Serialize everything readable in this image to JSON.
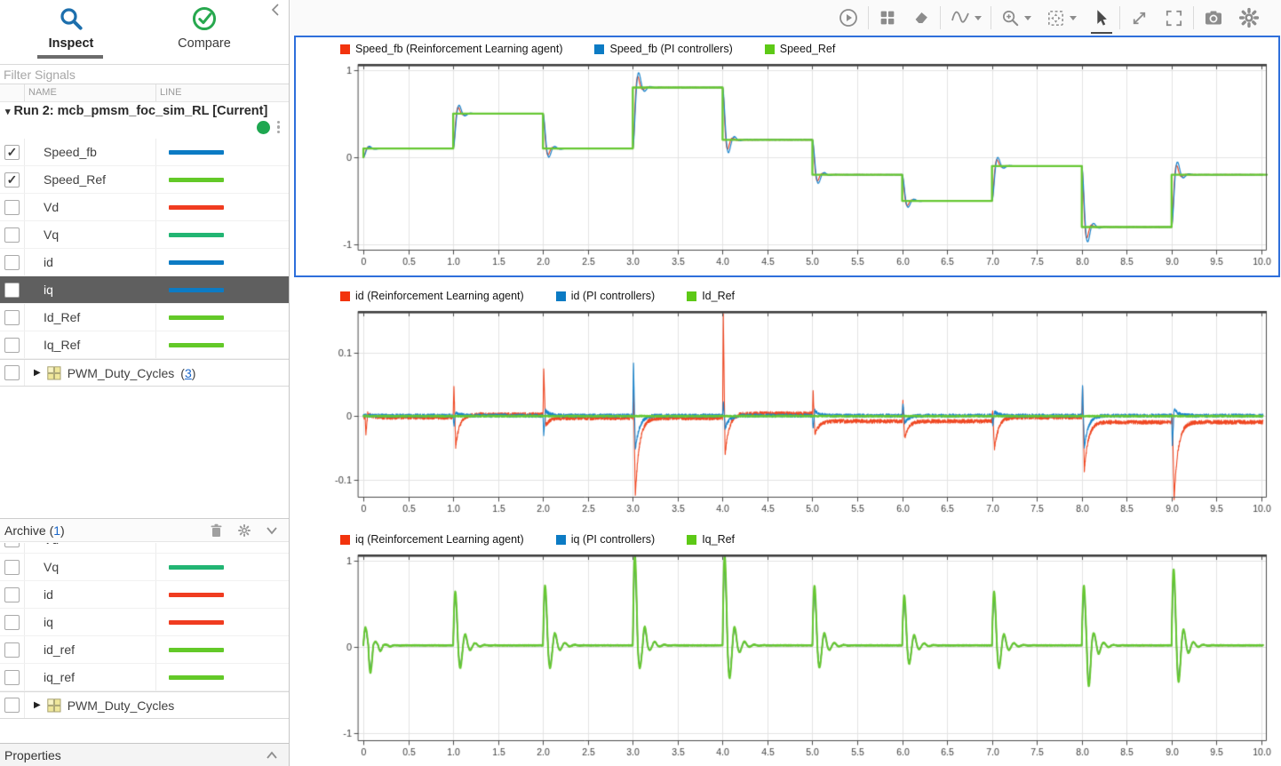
{
  "colors": {
    "accent_blue_selection": "#2E6FDB",
    "selected_row_bg": "#5F5F5F",
    "run_active_dot": "#1EA750",
    "link_blue": "#1A66C9",
    "series_red": "#EF4823",
    "series_blue": "#1B84CC",
    "series_green": "#66C832",
    "series_teal": "#22B573"
  },
  "sidebar": {
    "tabs": [
      {
        "label": "Inspect"
      },
      {
        "label": "Compare"
      }
    ],
    "collapse_icon": "chevron-left",
    "filter_placeholder": "Filter Signals",
    "columns": [
      "NAME",
      "LINE"
    ],
    "count_wrap": [
      "(",
      ")"
    ],
    "run": {
      "title": "Run 2: mcb_pmsm_foc_sim_RL [Current]",
      "signals": [
        {
          "name": "Speed_fb",
          "color": "#0C7BC4",
          "checked": true
        },
        {
          "name": "Speed_Ref",
          "color": "#63C928",
          "checked": true
        },
        {
          "name": "Vd",
          "color": "#F03C20",
          "checked": false
        },
        {
          "name": "Vq",
          "color": "#22B573",
          "checked": false
        },
        {
          "name": "id",
          "color": "#0C7BC4",
          "checked": false
        },
        {
          "name": "iq",
          "color": "#0C7BC4",
          "checked": false,
          "selected": true
        },
        {
          "name": "Id_Ref",
          "color": "#63C928",
          "checked": false
        },
        {
          "name": "Iq_Ref",
          "color": "#63C928",
          "checked": false
        },
        {
          "name": "PWM_Duty_Cycles",
          "group": true,
          "count": "3",
          "checked": false
        }
      ]
    },
    "archive": {
      "label": "Archive ",
      "count": "1",
      "signals": [
        {
          "name": "Vd",
          "color": "#F03C20",
          "checked": false,
          "clipped": true
        },
        {
          "name": "Vq",
          "color": "#22B573",
          "checked": false
        },
        {
          "name": "id",
          "color": "#F03C20",
          "checked": false
        },
        {
          "name": "iq",
          "color": "#F03C20",
          "checked": false
        },
        {
          "name": "id_ref",
          "color": "#63C928",
          "checked": false
        },
        {
          "name": "iq_ref",
          "color": "#63C928",
          "checked": false
        },
        {
          "name": "PWM_Duty_Cycles",
          "group": true,
          "checked": false
        }
      ]
    },
    "properties_label": "Properties"
  },
  "toolbar": {
    "icons": [
      "replay",
      "subplot-layout",
      "eraser",
      "signal-wave",
      "zoom-in",
      "fit-to-view",
      "pointer",
      "expand",
      "fullscreen",
      "snapshot",
      "settings"
    ],
    "active_icon": "pointer"
  },
  "chart_data": [
    {
      "type": "line",
      "legend": [
        {
          "label": "Speed_fb (Reinforcement Learning agent)",
          "color": "#F2330D"
        },
        {
          "label": "Speed_fb (PI controllers)",
          "color": "#0C7BC4"
        },
        {
          "label": "Speed_Ref",
          "color": "#5DC916"
        }
      ],
      "xlim": [
        -0.06,
        10.06
      ],
      "ylim": [
        -1.07,
        1.07
      ],
      "xtick_step": 0.5,
      "xtick_labels": [
        "0",
        "0.5",
        "1.0",
        "1.5",
        "2.0",
        "2.5",
        "3.0",
        "3.5",
        "4.0",
        "4.5",
        "5.0",
        "5.5",
        "6.0",
        "6.5",
        "7.0",
        "7.5",
        "8.0",
        "8.5",
        "9.0",
        "9.5",
        "10.0"
      ],
      "yticks": [
        {
          "v": 1,
          "l": "1"
        },
        {
          "v": 0,
          "l": "0"
        },
        {
          "v": -1,
          "l": "-1"
        }
      ],
      "steps": {
        "times": [
          0,
          1,
          2,
          3,
          4,
          5,
          6,
          7,
          8,
          9
        ],
        "values": [
          0.1,
          0.5,
          0.1,
          0.8,
          0.2,
          -0.2,
          -0.5,
          -0.1,
          -0.8,
          -0.2
        ],
        "initial": 0
      },
      "series": [
        {
          "name": "Speed_fb (Reinforcement Learning agent)",
          "color": "#EF4823",
          "kind": "step_response",
          "tau": 0.032,
          "period": 0.11,
          "noise": 0.003,
          "width": 1.2
        },
        {
          "name": "Speed_fb (PI controllers)",
          "color": "#1B84CC",
          "kind": "step_response",
          "tau": 0.046,
          "period": 0.13,
          "noise": 0.003,
          "width": 1.2
        },
        {
          "name": "Speed_Ref",
          "color": "#66C832",
          "kind": "step",
          "width": 2.3
        }
      ]
    },
    {
      "type": "line",
      "legend": [
        {
          "label": "id (Reinforcement Learning agent)",
          "color": "#F2330D"
        },
        {
          "label": "id (PI controllers)",
          "color": "#0C7BC4"
        },
        {
          "label": "Id_Ref",
          "color": "#5DC916"
        }
      ],
      "xlim": [
        -0.06,
        10.06
      ],
      "ylim": [
        -0.128,
        0.165
      ],
      "xtick_step": 0.5,
      "xtick_labels": [
        "0",
        "0.5",
        "1.0",
        "1.5",
        "2.0",
        "2.5",
        "3.0",
        "3.5",
        "4.0",
        "4.5",
        "5.0",
        "5.5",
        "6.0",
        "6.5",
        "7.0",
        "7.5",
        "8.0",
        "8.5",
        "9.0",
        "9.5",
        "10.0"
      ],
      "yticks": [
        {
          "v": 0.1,
          "l": "0.1"
        },
        {
          "v": 0,
          "l": "0"
        },
        {
          "v": -0.1,
          "l": "-0.1"
        }
      ],
      "series": [
        {
          "name": "id (Reinforcement Learning agent)",
          "color": "#EF4823",
          "kind": "spikes",
          "width": 1.1,
          "noise": 0.0032,
          "baseline": [
            [
              0,
              1,
              -0.002
            ],
            [
              1,
              2,
              0.0025
            ],
            [
              2,
              4,
              -0.003
            ],
            [
              4,
              5,
              0.004
            ],
            [
              5,
              7,
              -0.008
            ],
            [
              7,
              8,
              -0.002
            ],
            [
              8,
              10,
              -0.0095
            ]
          ],
          "events": [
            {
              "t": 0.02,
              "a1": -0.025,
              "a2": 0.006
            },
            {
              "t": 1,
              "a1": 0.045,
              "a2": -0.05
            },
            {
              "t": 2,
              "a1": 0.078,
              "a2": -0.012
            },
            {
              "t": 3,
              "a1": 0.045,
              "a2": -0.122
            },
            {
              "t": 4,
              "a1": 0.155,
              "a2": -0.065
            },
            {
              "t": 5,
              "a1": 0.048,
              "a2": -0.022
            },
            {
              "t": 6,
              "a1": 0.03,
              "a2": -0.027
            },
            {
              "t": 7,
              "a1": 0.008,
              "a2": -0.05
            },
            {
              "t": 8,
              "a1": 0.057,
              "a2": -0.076
            },
            {
              "t": 9,
              "a1": 0.015,
              "a2": -0.12
            }
          ]
        },
        {
          "name": "id (PI controllers)",
          "color": "#1B84CC",
          "kind": "spikes",
          "width": 1.1,
          "noise": 0.0028,
          "baseline": [
            [
              0,
              10,
              0.0008
            ]
          ],
          "events": [
            {
              "t": 1,
              "a1": -0.017,
              "a2": 0.006
            },
            {
              "t": 2,
              "a1": -0.03,
              "a2": 0.008
            },
            {
              "t": 3,
              "a1": 0.085,
              "a2": -0.055
            },
            {
              "t": 4,
              "a1": 0.02,
              "a2": -0.02
            },
            {
              "t": 5,
              "a1": -0.02,
              "a2": 0.008
            },
            {
              "t": 6,
              "a1": 0.02,
              "a2": -0.012
            },
            {
              "t": 7,
              "a1": -0.016,
              "a2": 0.006
            },
            {
              "t": 8,
              "a1": 0.05,
              "a2": -0.05
            },
            {
              "t": 9,
              "a1": -0.05,
              "a2": 0.01
            }
          ]
        },
        {
          "name": "Id_Ref",
          "color": "#66C832",
          "kind": "flat",
          "width": 1.6,
          "noise": 0.0012,
          "baseline": [
            [
              0,
              10,
              0
            ]
          ]
        }
      ]
    },
    {
      "type": "line",
      "legend": [
        {
          "label": "iq (Reinforcement Learning agent)",
          "color": "#F2330D"
        },
        {
          "label": "iq (PI controllers)",
          "color": "#0C7BC4"
        },
        {
          "label": "Iq_Ref",
          "color": "#5DC916"
        }
      ],
      "xlim": [
        -0.06,
        10.06
      ],
      "ylim": [
        -1.09,
        1.07
      ],
      "xtick_step": 0.5,
      "xtick_labels": [
        "0",
        "0.5",
        "1.0",
        "1.5",
        "2.0",
        "2.5",
        "3.0",
        "3.5",
        "4.0",
        "4.5",
        "5.0",
        "5.5",
        "6.0",
        "6.5",
        "7.0",
        "7.5",
        "8.0",
        "8.5",
        "9.0",
        "9.5",
        "10.0"
      ],
      "yticks": [
        {
          "v": 1,
          "l": "1"
        },
        {
          "v": 0,
          "l": "0"
        },
        {
          "v": -1,
          "l": "-1"
        }
      ],
      "events": [
        {
          "t": 0,
          "a1": 0.2,
          "a2": -0.3
        },
        {
          "t": 1,
          "a1": 0.6,
          "a2": -0.25
        },
        {
          "t": 2,
          "a1": -0.55,
          "a2": 0.3
        },
        {
          "t": 3,
          "a1": 1.0,
          "a2": -0.25
        },
        {
          "t": 4,
          "a1": -0.8,
          "a2": 0.45
        },
        {
          "t": 5,
          "a1": -0.55,
          "a2": 0.3
        },
        {
          "t": 6,
          "a1": -0.45,
          "a2": 0.25
        },
        {
          "t": 7,
          "a1": 0.6,
          "a2": -0.25
        },
        {
          "t": 8,
          "a1": -1.0,
          "a2": 0.3
        },
        {
          "t": 9,
          "a1": 0.85,
          "a2": -0.4
        }
      ],
      "burst": {
        "tau": 0.07,
        "period": 0.11,
        "baseline": 0.018
      },
      "series": [
        {
          "name": "iq (Reinforcement Learning agent)",
          "color": "#EF4823",
          "kind": "burst",
          "scale": 0.93,
          "noise": 0.004,
          "width": 1.3
        },
        {
          "name": "iq (PI controllers)",
          "color": "#1B84CC",
          "kind": "burst",
          "scale": 0.88,
          "noise": 0.004,
          "width": 1.3
        },
        {
          "name": "Iq_Ref",
          "color": "#66C832",
          "kind": "burst",
          "scale": 1.0,
          "noise": 0.005,
          "width": 2.0
        }
      ]
    }
  ]
}
